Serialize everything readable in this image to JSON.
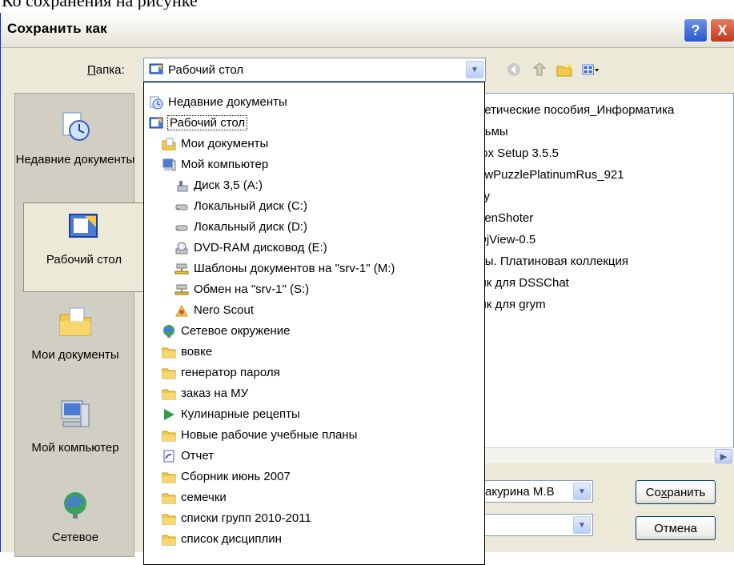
{
  "page_top_text": "Ко сохранения на рисунке",
  "window": {
    "title": "Сохранить как",
    "help_label": "?",
    "close_label": "X"
  },
  "folder": {
    "label": "Папка:",
    "label_hotkey": "П",
    "label_rest": "апка:",
    "value": "Рабочий стол"
  },
  "places": [
    {
      "label": "Недавние документы",
      "icon": "recent-documents-icon"
    },
    {
      "label": "Рабочий стол",
      "icon": "desktop-icon"
    },
    {
      "label": "Мои документы",
      "icon": "my-documents-icon"
    },
    {
      "label": "Мой компьютер",
      "icon": "my-computer-icon"
    },
    {
      "label": "Сетевое",
      "icon": "network-icon"
    }
  ],
  "files_visible": [
    "ретические пособия_Информатика",
    "льмы",
    "fox Setup 3.5.5",
    "awPuzzlePlatinumRus_921",
    "су",
    "eenShoter",
    "DjView-0.5",
    "лы. Платиновая коллекция",
    "ык для DSSChat",
    "ык для grym"
  ],
  "dropdown_items": [
    {
      "label": "Недавние документы",
      "icon": "recent-documents-icon",
      "level": 0
    },
    {
      "label": "Рабочий стол",
      "icon": "desktop-icon",
      "level": 0,
      "selected": true
    },
    {
      "label": "Мои документы",
      "icon": "my-documents-icon",
      "level": 1
    },
    {
      "label": "Мой компьютер",
      "icon": "my-computer-icon",
      "level": 1
    },
    {
      "label": "Диск 3,5 (A:)",
      "icon": "floppy-icon",
      "level": 2
    },
    {
      "label": "Локальный диск (C:)",
      "icon": "hard-drive-icon",
      "level": 2
    },
    {
      "label": "Локальный диск (D:)",
      "icon": "hard-drive-icon",
      "level": 2
    },
    {
      "label": "DVD-RAM дисковод (E:)",
      "icon": "dvd-drive-icon",
      "level": 2
    },
    {
      "label": "Шаблоны документов на \"srv-1\" (M:)",
      "icon": "network-drive-icon",
      "level": 2
    },
    {
      "label": "Обмен на \"srv-1\" (S:)",
      "icon": "network-drive-icon",
      "level": 2
    },
    {
      "label": "Nero Scout",
      "icon": "nero-scout-icon",
      "level": 2
    },
    {
      "label": "Сетевое окружение",
      "icon": "network-neighborhood-icon",
      "level": 1
    },
    {
      "label": "вовке",
      "icon": "folder-icon",
      "level": 1
    },
    {
      "label": "генератор пароля",
      "icon": "folder-icon",
      "level": 1
    },
    {
      "label": "заказ на МУ",
      "icon": "folder-icon",
      "level": 1
    },
    {
      "label": "Кулинарные рецепты",
      "icon": "play-arrow-icon",
      "level": 1
    },
    {
      "label": "Новые рабочие учебные планы",
      "icon": "folder-icon",
      "level": 1
    },
    {
      "label": "Отчет",
      "icon": "shortcut-document-icon",
      "level": 1
    },
    {
      "label": "Сборник июнь 2007",
      "icon": "folder-icon",
      "level": 1
    },
    {
      "label": "семечки",
      "icon": "folder-icon",
      "level": 1
    },
    {
      "label": "списки групп 2010-2011",
      "icon": "folder-icon",
      "level": 1
    },
    {
      "label": "список дисциплин",
      "icon": "folder-icon",
      "level": 1
    }
  ],
  "filename": {
    "value": "акурина М.В"
  },
  "buttons": {
    "save": "Сохранить",
    "save_hotkey_prefix": "Со",
    "save_hotkey": "х",
    "save_rest": "ранить",
    "cancel": "Отмена"
  },
  "colors": {
    "dialog_bg": "#ece9d8",
    "places_bg": "#d1cfc4",
    "border_blue": "#7f9db9",
    "close_red": "#c4381a",
    "help_blue": "#2a56cf"
  }
}
